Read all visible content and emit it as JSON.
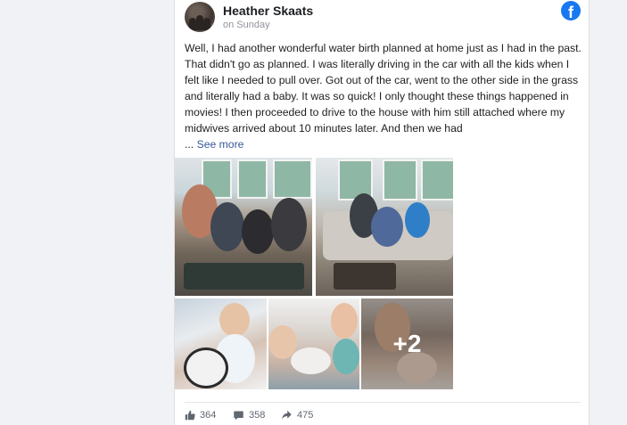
{
  "post": {
    "author": "Heather Skaats",
    "timestamp": "on Sunday",
    "text": "Well, I had another wonderful water birth planned at home just as I had in the past. That didn't go as planned. I was literally driving in the car with all the kids when I felt like I needed to pull over. Got out of the car, went to the other side in the grass and literally had a baby. It was so quick! I only thought these things happened in movies! I then proceeded to drive to the house with him still attached where my midwives arrived about 10 minutes later. And then we had",
    "ellipsis": "...",
    "see_more": "See more"
  },
  "photos": {
    "more_count": "+2"
  },
  "stats": {
    "likes": "364",
    "comments": "358",
    "shares": "475"
  },
  "colors": {
    "facebook_blue": "#1877f2",
    "link": "#385898",
    "muted": "#606770",
    "background": "#f0f2f5"
  },
  "icons": [
    "facebook-logo-icon",
    "like-icon",
    "comment-icon",
    "share-icon"
  ]
}
